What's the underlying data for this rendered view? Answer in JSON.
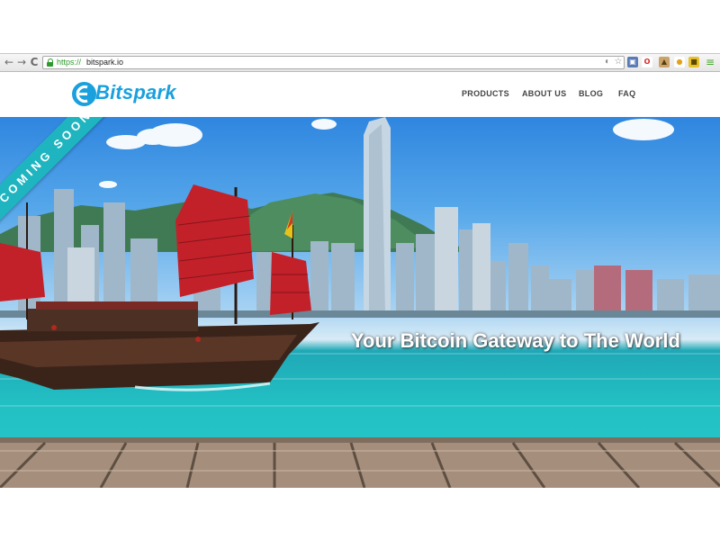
{
  "browser": {
    "url_scheme": "https://",
    "url_rest": "bitspark.io",
    "back_glyph": "←",
    "forward_glyph": "→",
    "reload_glyph": "C",
    "extension_icons": [
      {
        "name": "shield-icon",
        "glyph": "◐",
        "color": "#9a9a9a"
      },
      {
        "name": "star-icon",
        "glyph": "☆",
        "color": "#9a9a9a"
      },
      {
        "name": "window-icon",
        "glyph": "▣",
        "color": "#5a7bb5"
      },
      {
        "name": "opera-icon",
        "glyph": "O",
        "color": "#d22b2b"
      },
      {
        "name": "bag-icon",
        "glyph": "▲",
        "color": "#8a6a3a"
      },
      {
        "name": "lock-ext-icon",
        "glyph": "●",
        "color": "#e2a31a"
      },
      {
        "name": "badge-icon",
        "glyph": "■",
        "color": "#d9b118"
      },
      {
        "name": "menu-icon",
        "glyph": "≡",
        "color": "#4aa82f"
      }
    ]
  },
  "site": {
    "logo_text": "Bitspark",
    "brand_color": "#1aa0dd",
    "nav": [
      {
        "label": "PRODUCTS"
      },
      {
        "label": "ABOUT US"
      },
      {
        "label": "BLOG"
      },
      {
        "label": "FAQ"
      }
    ]
  },
  "hero": {
    "ribbon": "COMING SOON",
    "tagline": "Your Bitcoin Gateway to The World"
  }
}
